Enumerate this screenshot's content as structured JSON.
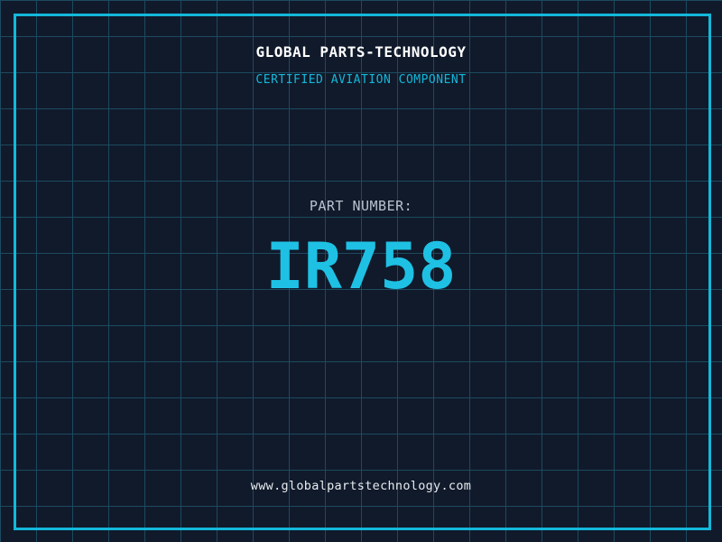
{
  "theme": {
    "background_color": "#101a2b",
    "grid_color": "#1d4a5f",
    "accent_color": "#14b8da",
    "part_number_color": "#1ec1e4",
    "title_color": "#ffffff",
    "label_color": "#b9c3cf",
    "footer_color": "#e8ecf0"
  },
  "header": {
    "brand": "GLOBAL PARTS-TECHNOLOGY",
    "tagline": "CERTIFIED AVIATION COMPONENT"
  },
  "part": {
    "label": "PART NUMBER:",
    "number": "IR758"
  },
  "footer": {
    "website": "www.globalpartstechnology.com"
  }
}
